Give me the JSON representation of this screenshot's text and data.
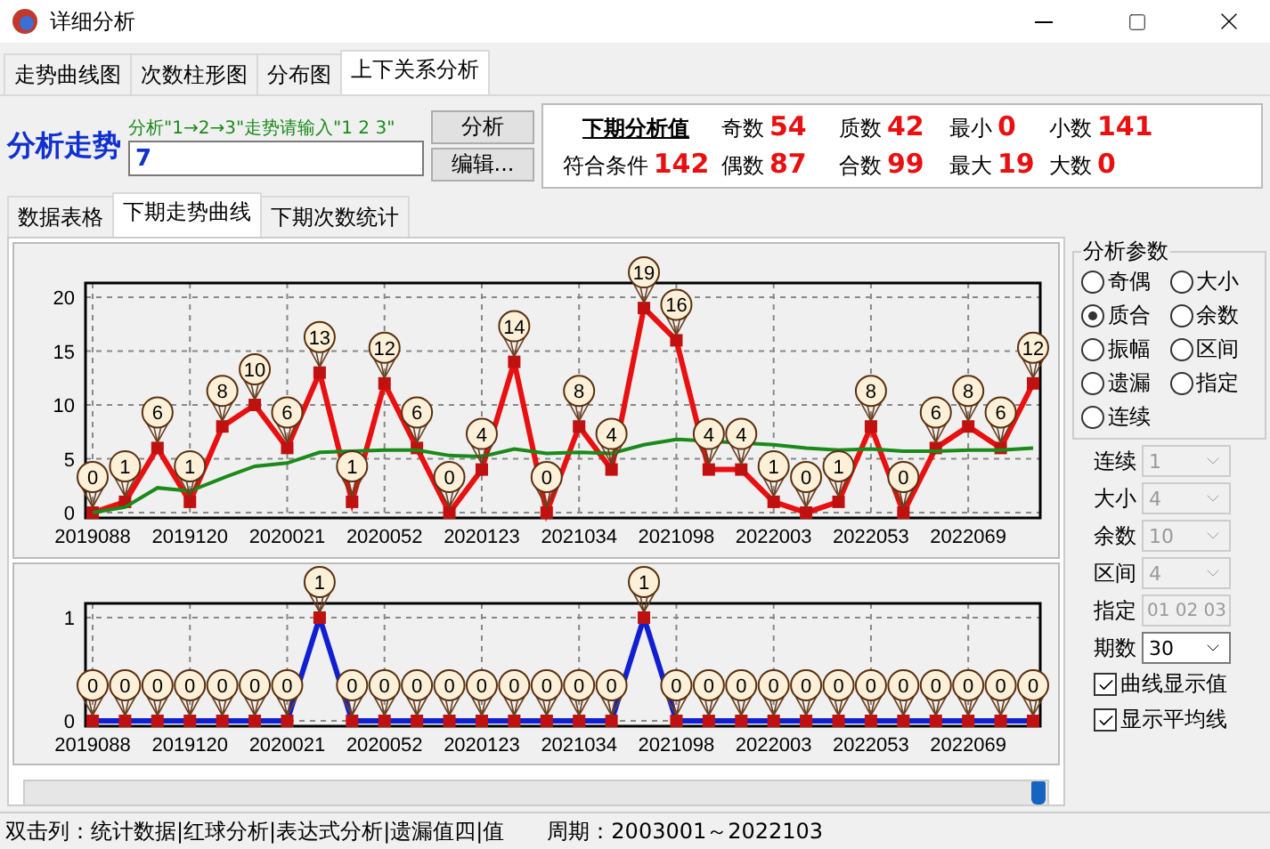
{
  "window": {
    "title": "详细分析"
  },
  "tabs": [
    {
      "label": "走势曲线图",
      "selected": false
    },
    {
      "label": "次数柱形图",
      "selected": false
    },
    {
      "label": "分布图",
      "selected": false
    },
    {
      "label": "上下关系分析",
      "selected": true
    }
  ],
  "analysis": {
    "heading": "分析走势",
    "hint": "分析\"1→2→3\"走势请输入\"1 2 3\"",
    "value": "7",
    "buttons": [
      "分析",
      "编辑..."
    ]
  },
  "summary": {
    "title": "下期分析值",
    "match_label": "符合条件",
    "match_value": "142",
    "stats": [
      {
        "label": "奇数",
        "value": "54"
      },
      {
        "label": "偶数",
        "value": "87"
      },
      {
        "label": "质数",
        "value": "42"
      },
      {
        "label": "合数",
        "value": "99"
      },
      {
        "label": "最小",
        "value": "0"
      },
      {
        "label": "最大",
        "value": "19"
      },
      {
        "label": "小数",
        "value": "141"
      },
      {
        "label": "大数",
        "value": "0"
      }
    ]
  },
  "sub_tabs": [
    {
      "label": "数据表格",
      "selected": false
    },
    {
      "label": "下期走势曲线",
      "selected": true
    },
    {
      "label": "下期次数统计",
      "selected": false
    }
  ],
  "charts": [
    {
      "chart_data": {
        "type": "line",
        "ylim": [
          0,
          20
        ],
        "yticks": [
          0,
          5,
          10,
          15,
          20
        ],
        "grid": true,
        "value_labels": [
          [
            "0",
            "1",
            "6",
            "1",
            "8",
            "10",
            "6",
            "13",
            "1",
            "12",
            "6",
            "0",
            "4",
            "14",
            "0",
            "8",
            "4",
            "19",
            "16",
            "4",
            "4",
            "1",
            "0",
            "1",
            "8",
            "0",
            "6",
            "8",
            "6",
            "12"
          ],
          null
        ],
        "categories": [
          "2019088",
          null,
          null,
          "2019120",
          null,
          null,
          "2020021",
          null,
          null,
          "2020052",
          null,
          null,
          "2020123",
          null,
          null,
          "2021034",
          null,
          null,
          "2021098",
          null,
          null,
          "2022003",
          null,
          null,
          "2022053",
          null,
          null,
          "2022069",
          null,
          null
        ],
        "series": [
          {
            "color": "#e81010",
            "marker": "square",
            "values": [
              0,
              1,
              6,
              1,
              8,
              10,
              6,
              13,
              1,
              12,
              6,
              0,
              4,
              14,
              0,
              8,
              4,
              19,
              16,
              4,
              4,
              1,
              0,
              1,
              8,
              0,
              6,
              8,
              6,
              12
            ]
          },
          {
            "color": "#1a8a1a",
            "values": [
              0,
              0.5,
              2.3,
              2,
              3.2,
              4.3,
              4.6,
              5.6,
              null,
              5.8,
              5.8,
              5.3,
              5.2,
              5.9,
              5.5,
              5.6,
              5.5,
              6.3,
              6.8,
              null,
              null,
              6.3,
              6,
              5.8,
              5.9,
              5.7,
              5.7,
              5.8,
              5.8,
              6
            ]
          }
        ]
      }
    },
    {
      "chart_data": {
        "type": "line",
        "ylim": [
          0,
          1
        ],
        "yticks": [
          0,
          1
        ],
        "grid": true,
        "value_labels": [
          [
            "0",
            "0",
            "0",
            "0",
            "0",
            "0",
            "0",
            "1",
            "0",
            "0",
            "0",
            "0",
            "0",
            "0",
            "0",
            "0",
            "0",
            "1",
            "0",
            "0",
            "0",
            "0",
            "0",
            "0",
            "0",
            "0",
            "0",
            "0",
            "0",
            "0"
          ]
        ],
        "categories": [
          "2019088",
          null,
          null,
          "2019120",
          null,
          null,
          "2020021",
          null,
          null,
          "2020052",
          null,
          null,
          "2020123",
          null,
          null,
          "2021034",
          null,
          null,
          "2021098",
          null,
          null,
          "2022003",
          null,
          null,
          "2022053",
          null,
          null,
          "2022069",
          null,
          null
        ],
        "series": [
          {
            "color": "#1020d0",
            "marker": "square",
            "values": [
              0,
              0,
              0,
              0,
              0,
              0,
              0,
              1,
              0,
              0,
              0,
              0,
              0,
              0,
              0,
              0,
              0,
              1,
              0,
              0,
              0,
              0,
              0,
              0,
              0,
              0,
              0,
              0,
              0,
              0
            ]
          }
        ]
      }
    }
  ],
  "params": {
    "title": "分析参数",
    "options": [
      {
        "label": "奇偶",
        "selected": false
      },
      {
        "label": "大小",
        "selected": false
      },
      {
        "label": "质合",
        "selected": true
      },
      {
        "label": "余数",
        "selected": false
      },
      {
        "label": "振幅",
        "selected": false
      },
      {
        "label": "区间",
        "selected": false
      },
      {
        "label": "遗漏",
        "selected": false
      },
      {
        "label": "指定",
        "selected": false
      },
      {
        "label": "连续",
        "selected": false
      }
    ],
    "fields": [
      {
        "kind": "dropdown",
        "label": "连续",
        "value": "1",
        "disabled": true
      },
      {
        "kind": "dropdown",
        "label": "大小",
        "value": "4",
        "disabled": true
      },
      {
        "kind": "dropdown",
        "label": "余数",
        "value": "10",
        "disabled": true
      },
      {
        "kind": "dropdown",
        "label": "区间",
        "value": "4",
        "disabled": true
      },
      {
        "kind": "text",
        "label": "指定",
        "value": "01 02 03",
        "disabled": true
      },
      {
        "kind": "dropdown",
        "label": "期数",
        "value": "30",
        "disabled": false
      }
    ],
    "show_values": {
      "label": "曲线显示值",
      "checked": true
    },
    "show_average": {
      "label": "显示平均线",
      "checked": true
    }
  },
  "status_bar": {
    "hint": "双击列：统计数据|红球分析|表达式分析|遗漏值四|值",
    "period": "周期：2003001～2022103"
  }
}
